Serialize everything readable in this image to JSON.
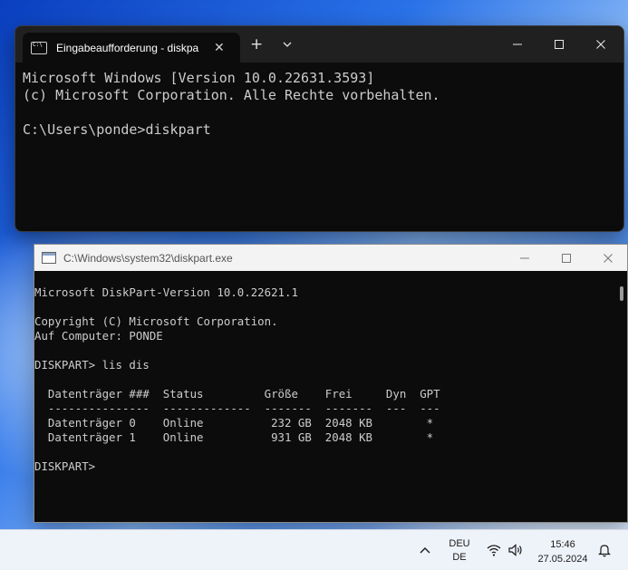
{
  "terminal": {
    "tab_title": "Eingabeaufforderung - diskpa",
    "tab_close": "✕",
    "new_tab": "+",
    "lines": [
      "Microsoft Windows [Version 10.0.22631.3593]",
      "(c) Microsoft Corporation. Alle Rechte vorbehalten.",
      "",
      "C:\\Users\\ponde>diskpart"
    ]
  },
  "diskpart_window": {
    "title": "C:\\Windows\\system32\\diskpart.exe",
    "lines": [
      "Microsoft DiskPart-Version 10.0.22621.1",
      "",
      "Copyright (C) Microsoft Corporation.",
      "Auf Computer: PONDE",
      "",
      "DISKPART> lis dis",
      "",
      "  Datenträger ###  Status         Größe    Frei     Dyn  GPT",
      "  ---------------  -------------  -------  -------  ---  ---",
      "  Datenträger 0    Online          232 GB  2048 KB        *",
      "  Datenträger 1    Online          931 GB  2048 KB        *",
      "",
      "DISKPART> "
    ]
  },
  "taskbar": {
    "language_line1": "DEU",
    "language_line2": "DE",
    "time": "15:46",
    "date": "27.05.2024"
  },
  "icons": [
    "cmd-icon",
    "tab-close-icon",
    "new-tab-icon",
    "dropdown-icon",
    "minimize-icon",
    "maximize-icon",
    "close-icon",
    "console-icon",
    "tray-chevron-icon",
    "wifi-icon",
    "volume-icon",
    "notification-bell-icon"
  ]
}
